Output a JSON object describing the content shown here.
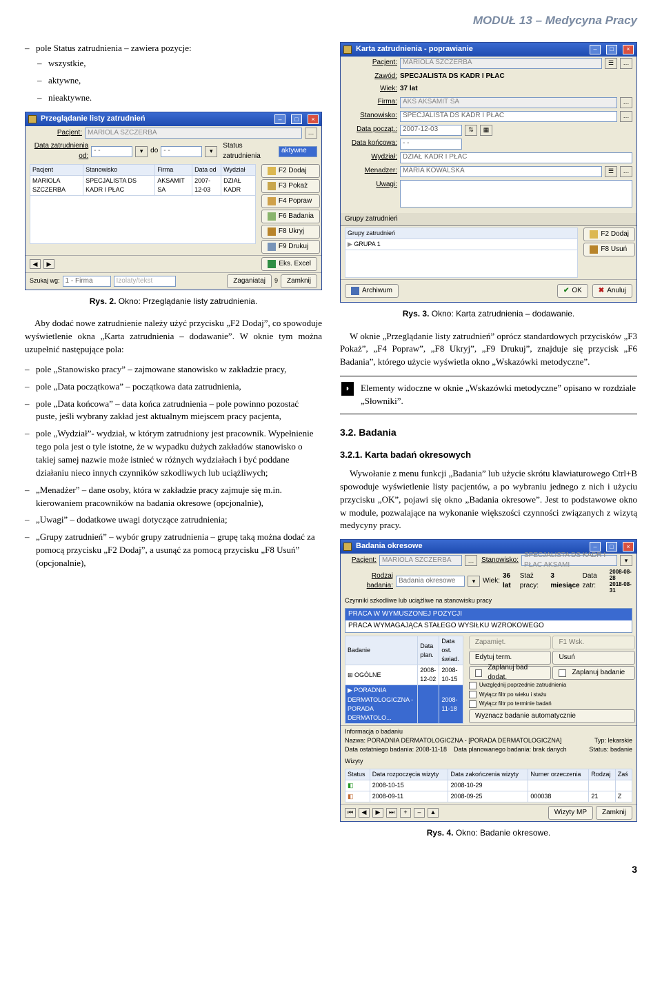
{
  "header": "MODUŁ 13 – Medycyna Pracy",
  "page_number": "3",
  "left": {
    "intro_label": "pole Status zatrudnienia – zawiera pozycje:",
    "statuses": [
      "wszystkie,",
      "aktywne,",
      "nieaktywne."
    ],
    "fig2_caption_label": "Rys. 2.",
    "fig2_caption_text": "Okno: Przeglądanie listy zatrudnienia.",
    "p1": "Aby dodać nowe zatrudnienie należy użyć przycisku „F2 Dodaj”, co spowoduje wyświetlenie okna „Karta zatrudnienia – dodawanie”. W oknie tym można uzupełnić następujące pola:",
    "fields": [
      "pole „Stanowisko pracy” – zajmowane stanowisko w zakładzie pracy,",
      "pole „Data początkowa” – początkowa data zatrudnienia,",
      "pole „Data końcowa” – data końca zatrudnienia – pole powinno pozostać puste, jeśli wybrany zakład jest aktualnym miejscem pracy pacjenta,",
      "pole „Wydział”- wydział, w którym zatrudniony jest pracownik. Wypełnienie tego pola jest o tyle istotne, że w wypadku dużych zakładów stanowisko o takiej samej nazwie może istnieć w różnych wydziałach i być poddane działaniu nieco innych czynników szkodliwych lub uciążliwych;",
      "„Menadżer” – dane osoby, która w zakładzie pracy zajmuje się m.in. kierowaniem pracowników na badania okresowe (opcjonalnie),",
      "„Uwagi” – dodatkowe uwagi dotyczące zatrudnienia;",
      "„Grupy zatrudnień” – wybór grupy zatrudnienia – grupę taką można dodać za pomocą przycisku „F2 Dodaj”, a usunąć za pomocą przycisku „F8 Usuń” (opcjonalnie),"
    ]
  },
  "right": {
    "fig3_caption_label": "Rys. 3.",
    "fig3_caption_text": "Okno: Karta zatrudnienia – dodawanie.",
    "p1": "W oknie „Przeglądanie listy zatrudnień” oprócz standardowych przycisków „F3 Pokaż”, „F4 Popraw”, „F8 Ukryj”, „F9 Drukuj”, znajduje się przycisk „F6 Badania”, którego użycie wyświetla okno „Wskazówki metodyczne”.",
    "tip": "Elementy widoczne w oknie „Wskazówki metodyczne” opisano w rozdziale „Słowniki”.",
    "sec32": "3.2.   Badania",
    "sec321": "3.2.1.   Karta badań okresowych",
    "p2": "Wywołanie z menu funkcji „Badania” lub użycie skrótu klawiaturowego Ctrl+B spowoduje wyświetlenie listy pacjentów, a po wybraniu jednego z nich i użyciu przycisku „OK”, pojawi się okno „Badania okresowe”. Jest to podstawowe okno w module, pozwalające na wykonanie większości czynności związanych z wizytą medycyny pracy.",
    "fig4_caption_label": "Rys. 4.",
    "fig4_caption_text": "Okno: Badanie okresowe."
  },
  "win1": {
    "title": "Przeglądanie listy zatrudnień",
    "pacjent_label": "Pacjent:",
    "pacjent_value": "MARIOLA SZCZERBA",
    "data_od_label": "Data zatrudnienia od:",
    "data_do_label": "do",
    "status_label": "Status zatrudnienia",
    "status_value": "aktywne",
    "cols": [
      "Pacjent",
      "Stanowisko",
      "Firma",
      "Data od",
      "Wydział"
    ],
    "row": [
      "MARIOLA SZCZERBA",
      "SPECJALISTA DS KADR I PŁAC",
      "AKSAMIT SA",
      "2007-12-03",
      "DZIAŁ KADR"
    ],
    "sidebtns": [
      "F2 Dodaj",
      "F3 Pokaż",
      "F4 Popraw",
      "F6 Badania",
      "F8 Ukryj",
      "F9 Drukuj"
    ],
    "footer_label": "Szukaj wg:",
    "footer_value": "1 - Firma",
    "footer_filter": "Izolaty/tekst",
    "eks": "Eks. Excel",
    "zagan": "Zaganiataj",
    "count": "9",
    "close": "Zamknij"
  },
  "win2": {
    "title": "Karta zatrudnienia - poprawianie",
    "pacjent_label": "Pacjent:",
    "pacjent_value": "MARIOLA SZCZERBA",
    "zawod_label": "Zawód:",
    "zawod_value": "SPECJALISTA DS KADR I PŁAC",
    "wiek_label": "Wiek:",
    "wiek_value": "37 lat",
    "firma_label": "Firma:",
    "firma_value": "AKS AKSAMIT SA",
    "stan_label": "Stanowisko:",
    "stan_value": "SPECJALISTA DS KADR I PŁAC",
    "datap_label": "Data począt.:",
    "datap_value": "2007-12-03",
    "datak_label": "Data końcowa:",
    "datak_value": "- -",
    "wydz_label": "Wydział:",
    "wydz_value": "DZIAŁ KADR I PŁAC",
    "men_label": "Menadzer:",
    "men_value": "MARIA KOWALSKA",
    "uwagi_label": "Uwagi:",
    "grupy_hdr": "Grupy zatrudnień",
    "grupy_col": "Grupy zatrudnień",
    "grupy_row": "GRUPA 1",
    "f2": "F2 Dodaj",
    "f8": "F8 Usuń",
    "archiwum": "Archiwum",
    "ok": "OK",
    "anuluj": "Anuluj"
  },
  "win3": {
    "title": "Badania okresowe",
    "pacjent_label": "Pacjent:",
    "pacjent_value": "MARIOLA SZCZERBA",
    "stan_label": "Stanowisko:",
    "stan_value": "SPECJALISTA DS KADR I PŁAC  AKSAMI",
    "rodzaj_label": "Rodzaj badania:",
    "rodzaj_value": "Badania okresowe",
    "wiek_label": "Wiek:",
    "wiek_value": "36 lat",
    "staz_label": "Staż pracy:",
    "staz_value": "3 miesiące",
    "data_label": "Data zatr:",
    "data_value1": "2008-08-28",
    "data_value2": "2018-08-31",
    "czynniki_label": "Czynniki szkodliwe lub uciążliwe na stanowisku pracy",
    "czynniki_rows": [
      "PRACA W WYMUSZONEJ POZYCJI",
      "PRACA WYMAGAJĄCA STAŁEGO WYSIŁKU WZROKOWEGO"
    ],
    "bad_cols": [
      "Badanie",
      "Data plan.",
      "Data ost. świad."
    ],
    "bad_rows": [
      [
        "OGÓLNE",
        "2008-12-02",
        "2008-10-15"
      ],
      [
        "PORADNIA DERMATOLOGICZNA - PORADA DERMATOLO...",
        "",
        "2008-11-18"
      ]
    ],
    "sidebtns1": [
      "Zapamięt.",
      "F1 Wsk.",
      "Edytuj term.",
      "Usuń"
    ],
    "checks": [
      "Zaplanuj bad dodat.",
      "Zaplanuj badanie",
      "Uwzględnij poprzednie zatrudnienia",
      "Wyłącz filtr po wieku i stażu",
      "Wyłącz filtr po terminie badań"
    ],
    "wyzn": "Wyznacz badanie automatycznie",
    "info_label": "Informacja o badaniu",
    "info_name_label": "Nazwa:",
    "info_name": "PORADNIA DERMATOLOGICZNA - [PORADA DERMATOLOGICZNA]",
    "info_date_label": "Data ostatniego badania:",
    "info_date": "2008-11-18",
    "info_plan_label": "Data planowanego badania:",
    "info_plan": "brak danych",
    "info_typ_label": "Typ:",
    "info_typ": "lekarskie",
    "info_status_label": "Status:",
    "info_status": "badanie",
    "wiz_hdr": "Wizyty",
    "wiz_cols": [
      "Status",
      "Data rozpoczęcia wizyty",
      "Data zakończenia wizyty",
      "Numer orzeczenia",
      "Rodzaj",
      "Zaś"
    ],
    "wiz_rows": [
      [
        "",
        "2008-10-15",
        "2008-10-29",
        "",
        "",
        ""
      ],
      [
        "",
        "2008-09-11",
        "2008-09-25",
        "000038",
        "21",
        "Z"
      ]
    ],
    "footer_wizyty": "Wizyty MP",
    "footer_zamknij": "Zamknij"
  }
}
